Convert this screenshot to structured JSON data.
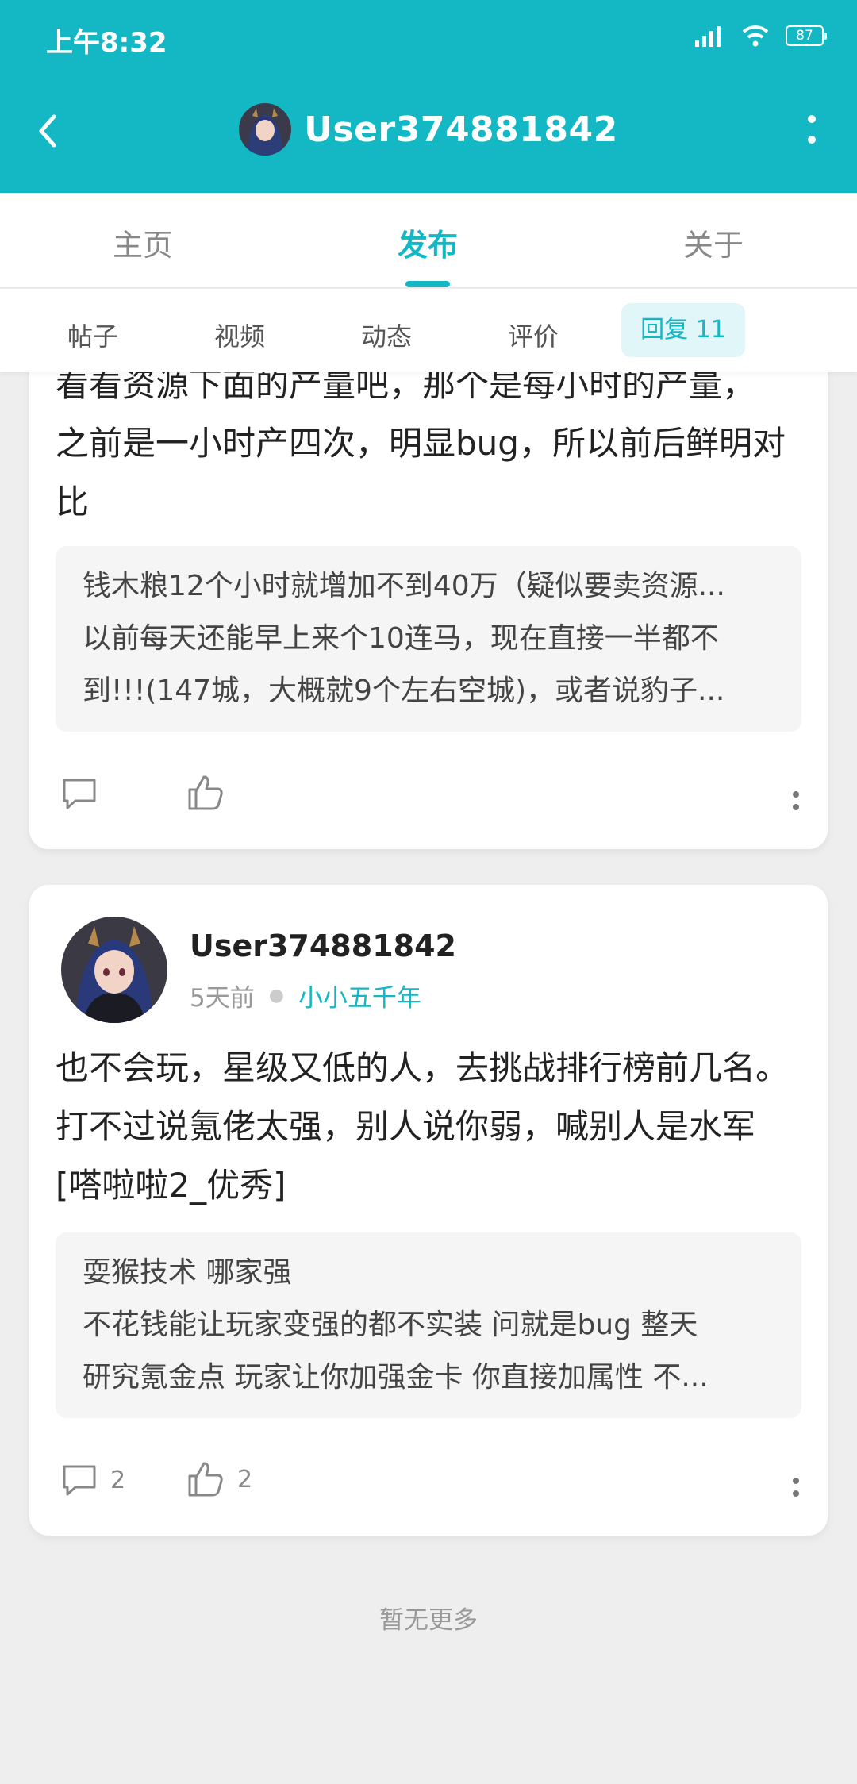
{
  "status": {
    "time": "上午8:32",
    "battery": "87"
  },
  "header": {
    "title": "User374881842"
  },
  "tabs": [
    {
      "label": "主页"
    },
    {
      "label": "发布"
    },
    {
      "label": "关于"
    }
  ],
  "subtabs": [
    {
      "label": "帖子"
    },
    {
      "label": "视频"
    },
    {
      "label": "动态"
    },
    {
      "label": "评价"
    },
    {
      "label": "回复 11"
    }
  ],
  "posts": [
    {
      "body_lines": [
        "看看资源下面的产量吧，那个是每小时的产量，",
        "之前是一小时产四次，明显bug，所以前后鲜明对",
        "比"
      ],
      "quote_lines": [
        "钱木粮12个小时就增加不到40万（疑似要卖资源...",
        "以前每天还能早上来个10连马，现在直接一半都不",
        "到!!!(147城，大概就9个左右空城)，或者说豹子..."
      ],
      "comment_count": "",
      "like_count": ""
    },
    {
      "author": "User374881842",
      "time": "5天前",
      "group": "小小五千年",
      "body_lines": [
        "也不会玩，星级又低的人，去挑战排行榜前几名。",
        "打不过说氪佬太强，别人说你弱，喊别人是水军",
        "[嗒啦啦2_优秀]"
      ],
      "quote_lines": [
        "耍猴技术  哪家强",
        "不花钱能让玩家变强的都不实装  问就是bug 整天",
        "研究氪金点  玩家让你加强金卡 你直接加属性 不..."
      ],
      "comment_count": "2",
      "like_count": "2"
    }
  ],
  "footer": {
    "no_more": "暂无更多"
  }
}
